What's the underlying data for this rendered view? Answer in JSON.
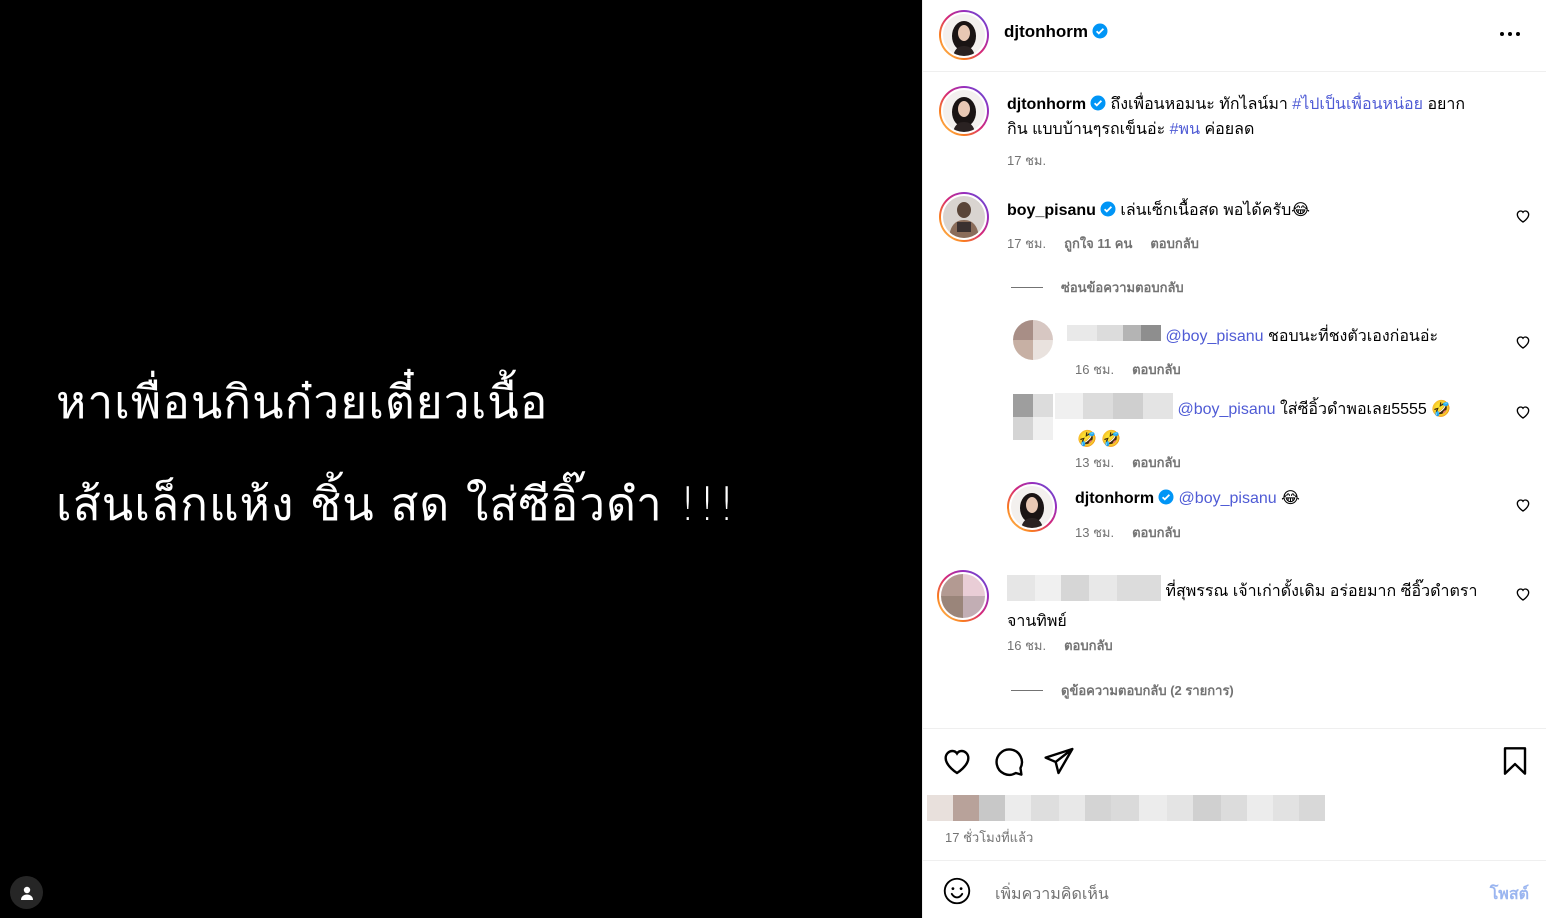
{
  "media": {
    "line1": "หาเพื่อนกินก๋วยเตี๋ยวเนื้อ",
    "line2": "เส้นเล็กแห้ง ชิ้น สด ใส่ซีอิ๊วดำ !!!"
  },
  "header": {
    "username": "djtonhorm"
  },
  "caption": {
    "username": "djtonhorm",
    "text_a": "ถึงเพื่อนหอมนะ ทักไลน์มา ",
    "hashtag1": "#ไปเป็นเพื่อนหน่อย",
    "text_b": " อยาก",
    "text_c": "กิน แบบบ้านๆรถเข็นอ่ะ ",
    "hashtag2": "#พน",
    "text_d": " ค่อยลด",
    "time": "17 ชม."
  },
  "comments": [
    {
      "username": "boy_pisanu",
      "text": "เล่นเซ็กเนื้อสด พอได้ครับ😂",
      "time": "17 ชม.",
      "likes": "ถูกใจ 11 คน",
      "reply": "ตอบกลับ",
      "toggle": "ซ่อนข้อความตอบกลับ"
    },
    {
      "mention": "@boy_pisanu",
      "text": " ชอบนะที่ชงตัวเองก่อนอ่ะ",
      "time": "16 ชม.",
      "reply": "ตอบกลับ"
    },
    {
      "mention": "@boy_pisanu",
      "text": " ใส่ซีอิ้วดำพอเลย5555 🤣",
      "text2": "🤣 🤣",
      "time": "13 ชม.",
      "reply": "ตอบกลับ"
    },
    {
      "username": "djtonhorm",
      "mention": "@boy_pisanu",
      "text": " 😂",
      "time": "13 ชม.",
      "reply": "ตอบกลับ"
    },
    {
      "text": " ที่สุพรรณ เจ้าเก่าดั้งเดิม อร่อยมาก ซีอิ๊วดำตรา",
      "text2": "จานทิพย์",
      "time": "16 ชม.",
      "reply": "ตอบกลับ",
      "toggle": "ดูข้อความตอบกลับ (2 รายการ)"
    }
  ],
  "actions": {
    "time_ago": "17 ชั่วโมงที่แล้ว"
  },
  "composer": {
    "placeholder": "เพิ่มความคิดเห็น",
    "post": "โพสต์"
  },
  "colors": {
    "link": "#4f5bd5",
    "verified": "#0095f6",
    "muted": "#737373",
    "post_disabled": "#9ab5f0"
  },
  "icons": [
    "person-tag-icon",
    "more-icon",
    "verified-icon",
    "heart-icon",
    "comment-icon",
    "share-icon",
    "bookmark-icon",
    "emoji-icon"
  ]
}
